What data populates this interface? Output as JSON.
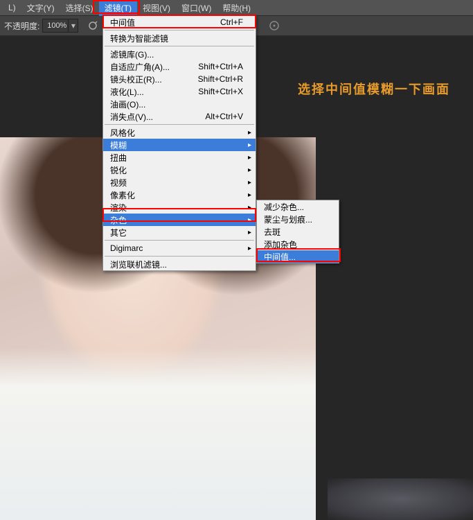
{
  "menubar": {
    "items": [
      "L)",
      "文字(Y)",
      "选择(S)",
      "滤镜(T)",
      "视图(V)",
      "窗口(W)",
      "帮助(H)"
    ],
    "active_index": 3
  },
  "toolbar": {
    "opacity_label": "不透明度:",
    "opacity_value": "100%"
  },
  "dropdown": {
    "recent": {
      "label": "中间值",
      "shortcut": "Ctrl+F"
    },
    "convert": "转换为智能滤镜",
    "group1": [
      {
        "label": "滤镜库(G)...",
        "shortcut": ""
      },
      {
        "label": "自适应广角(A)...",
        "shortcut": "Shift+Ctrl+A"
      },
      {
        "label": "镜头校正(R)...",
        "shortcut": "Shift+Ctrl+R"
      },
      {
        "label": "液化(L)...",
        "shortcut": "Shift+Ctrl+X"
      },
      {
        "label": "油画(O)...",
        "shortcut": ""
      },
      {
        "label": "消失点(V)...",
        "shortcut": "Alt+Ctrl+V"
      }
    ],
    "group2": [
      {
        "label": "风格化",
        "sub": true,
        "hl": false
      },
      {
        "label": "模糊",
        "sub": true,
        "hl": true
      },
      {
        "label": "扭曲",
        "sub": true,
        "hl": false
      },
      {
        "label": "锐化",
        "sub": true,
        "hl": false
      },
      {
        "label": "视频",
        "sub": true,
        "hl": false
      },
      {
        "label": "像素化",
        "sub": true,
        "hl": false
      },
      {
        "label": "渲染",
        "sub": true,
        "hl": false
      },
      {
        "label": "杂色",
        "sub": true,
        "hl": true,
        "selected": true
      },
      {
        "label": "其它",
        "sub": true,
        "hl": false
      }
    ],
    "digimarc": {
      "label": "Digimarc",
      "sub": true
    },
    "browse": "浏览联机滤镜..."
  },
  "submenu": {
    "items": [
      {
        "label": "减少杂色...",
        "hl": false
      },
      {
        "label": "蒙尘与划痕...",
        "hl": false
      },
      {
        "label": "去斑",
        "hl": false
      },
      {
        "label": "添加杂色",
        "hl": false
      },
      {
        "label": "中间值...",
        "hl": true
      }
    ]
  },
  "annotation": "选择中间值模糊一下画面"
}
